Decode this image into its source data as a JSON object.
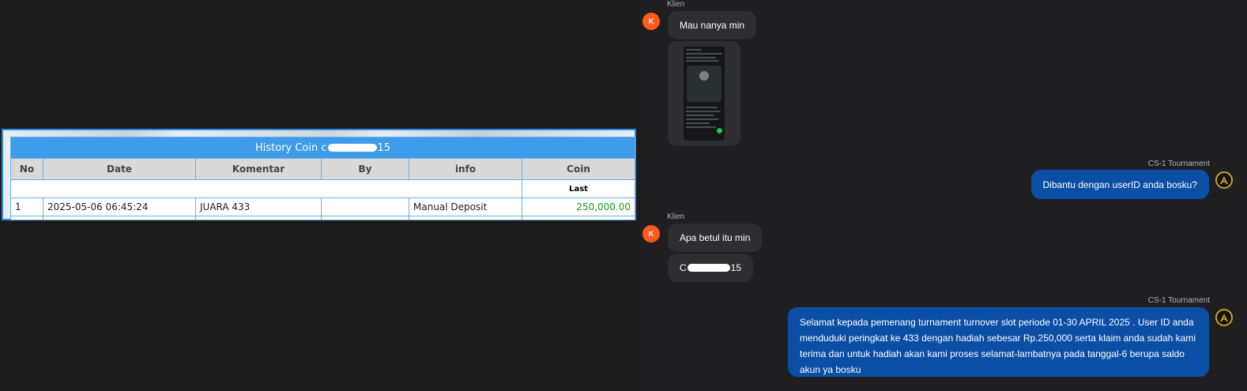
{
  "history": {
    "title_prefix": "History Coin c",
    "title_suffix": "15",
    "columns": [
      "No",
      "Date",
      "Komentar",
      "By",
      "info",
      "Coin"
    ],
    "sub_label": "Last",
    "rows": [
      {
        "no": "1",
        "date": "2025-05-06 06:45:24",
        "komentar": "JUARA 433",
        "by": "",
        "info": "Manual Deposit",
        "coin": "250,000.00"
      }
    ]
  },
  "chat": {
    "client_name": "Klien",
    "client_initial": "K",
    "agent_name": "CS-1 Tournament",
    "messages": {
      "m1": "Mau nanya min",
      "m2": "Dibantu dengan userID anda bosku?",
      "m3": "Apa betul itu min",
      "m4_prefix": "C",
      "m4_suffix": "15",
      "m5": "Selamat kepada pemenang turnament turnover slot periode 01-30 APRIL 2025 . User ID anda menduduki peringkat ke 433 dengan hadiah sebesar Rp.250,000 serta klaim anda sudah kami terima dan untuk hadiah akan kami proses selamat-lambatnya pada tanggal-6 berupa saldo akun ya bosku"
    }
  },
  "colors": {
    "table_header": "#3d9be9",
    "coin_value": "#1a9a1a",
    "client_avatar": "#ff5a1f",
    "agent_bubble": "#0b4ea6",
    "client_bubble": "#2e2e31",
    "agent_avatar_ring": "#c9a227"
  },
  "icons": {
    "agent_avatar": "gold-a-emblem-icon",
    "redaction": "redaction-bar"
  }
}
